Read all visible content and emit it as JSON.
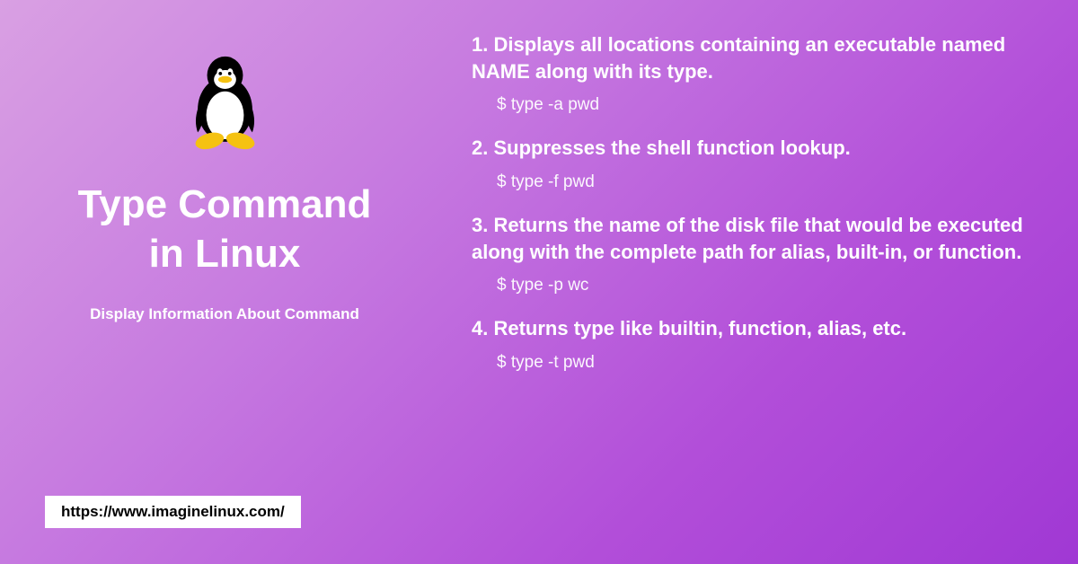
{
  "left": {
    "title_line1": "Type Command",
    "title_line2": "in Linux",
    "subtitle": "Display Information About Command",
    "url": "https://www.imaginelinux.com/"
  },
  "items": [
    {
      "heading": "1. Displays all locations containing an executable named NAME along with its type.",
      "command": "$ type -a pwd"
    },
    {
      "heading": "2. Suppresses the shell function lookup.",
      "command": "$ type -f pwd"
    },
    {
      "heading": "3. Returns the name of the disk file that would be executed along with the complete path for alias, built-in, or function.",
      "command": "$ type -p wc"
    },
    {
      "heading": "4. Returns type like builtin, function, alias, etc.",
      "command": "$ type -t pwd"
    }
  ]
}
